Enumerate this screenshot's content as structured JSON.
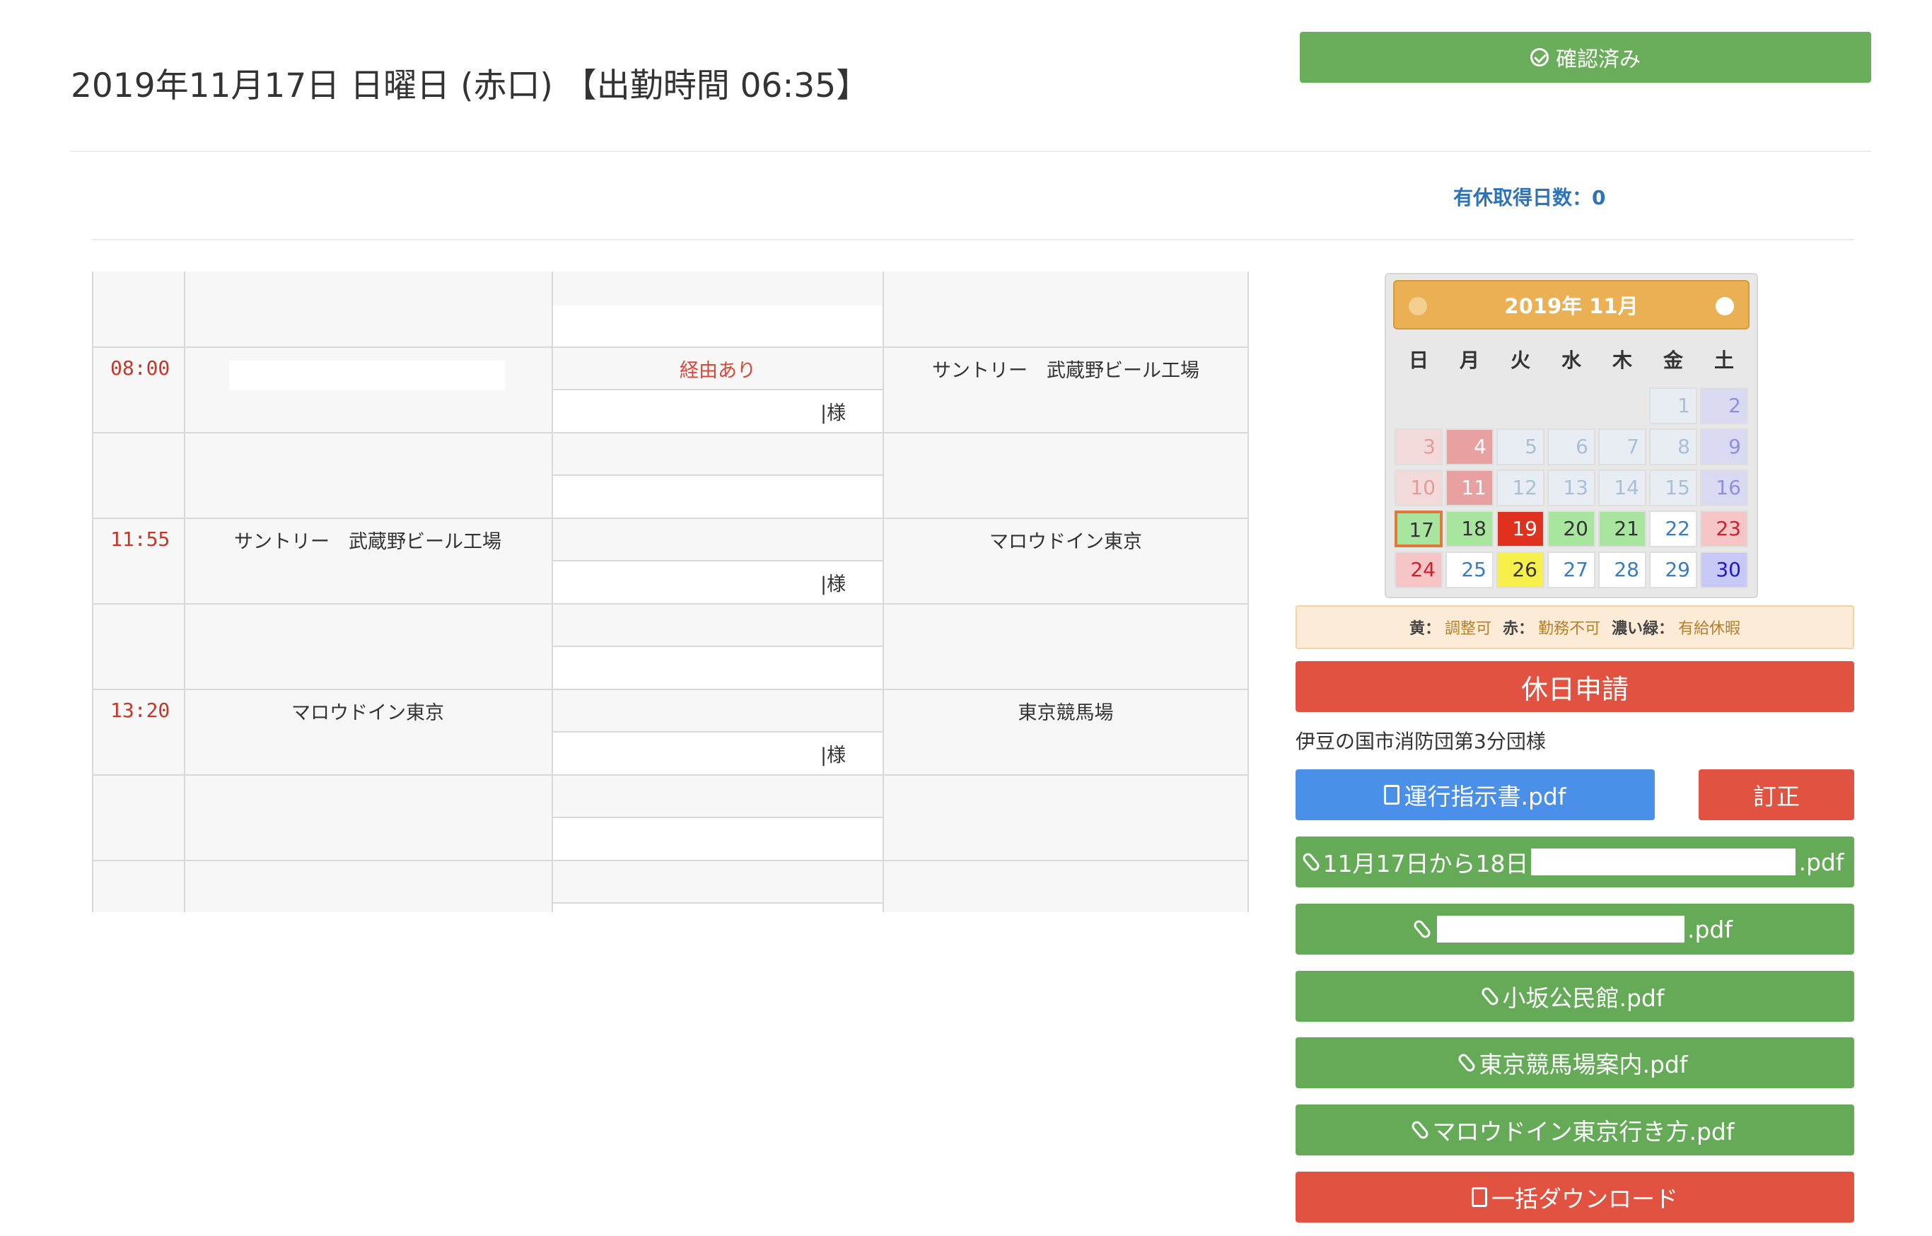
{
  "header": {
    "title": "2019年11月17日  日曜日  (赤口) 【出勤時間 06:35】",
    "confirm_label": "確認済み",
    "paid_leave": "有休取得日数：0"
  },
  "schedule": {
    "rows": [
      {
        "time": "",
        "from": "",
        "via_top": "",
        "via_bottom": "",
        "to": ""
      },
      {
        "time": "08:00",
        "from": "",
        "via_top": "経由あり",
        "via_bottom": "|様",
        "to": "サントリー　武蔵野ビール工場"
      },
      {
        "time": "",
        "from": "",
        "via_top": "",
        "via_bottom": "",
        "to": ""
      },
      {
        "time": "11:55",
        "from": "サントリー　武蔵野ビール工場",
        "via_top": "",
        "via_bottom": "|様",
        "to": "マロウドイン東京"
      },
      {
        "time": "",
        "from": "",
        "via_top": "",
        "via_bottom": "",
        "to": ""
      },
      {
        "time": "13:20",
        "from": "マロウドイン東京",
        "via_top": "",
        "via_bottom": "|様",
        "to": "東京競馬場"
      },
      {
        "time": "",
        "from": "",
        "via_top": "",
        "via_bottom": "",
        "to": ""
      },
      {
        "time": "",
        "from": "",
        "via_top": "",
        "via_bottom": "",
        "to": ""
      }
    ]
  },
  "calendar": {
    "title": "2019年 11月",
    "weekdays": [
      "日",
      "月",
      "火",
      "水",
      "木",
      "金",
      "土"
    ],
    "weeks": [
      [
        null,
        null,
        null,
        null,
        null,
        1,
        2
      ],
      [
        3,
        4,
        5,
        6,
        7,
        8,
        9
      ],
      [
        10,
        11,
        12,
        13,
        14,
        15,
        16
      ],
      [
        17,
        18,
        19,
        20,
        21,
        22,
        23
      ],
      [
        24,
        25,
        26,
        27,
        28,
        29,
        30
      ]
    ],
    "day_styles": {
      "1": {
        "bg": "#e8edf3",
        "fg": "#a8bfd6"
      },
      "2": {
        "bg": "#d9d9f2",
        "fg": "#8f8fdd"
      },
      "3": {
        "bg": "#f2dada",
        "fg": "#e79a9a"
      },
      "4": {
        "bg": "#e8a0a0",
        "fg": "#ffffff"
      },
      "5": {
        "bg": "#e8edf3",
        "fg": "#a8bfd6"
      },
      "6": {
        "bg": "#e8edf3",
        "fg": "#a8bfd6"
      },
      "7": {
        "bg": "#e8edf3",
        "fg": "#a8bfd6"
      },
      "8": {
        "bg": "#e8edf3",
        "fg": "#a8bfd6"
      },
      "9": {
        "bg": "#d9d9f2",
        "fg": "#8f8fdd"
      },
      "10": {
        "bg": "#f2dada",
        "fg": "#e79a9a"
      },
      "11": {
        "bg": "#e8a0a0",
        "fg": "#ffffff"
      },
      "12": {
        "bg": "#e8edf3",
        "fg": "#a8bfd6"
      },
      "13": {
        "bg": "#e8edf3",
        "fg": "#a8bfd6"
      },
      "14": {
        "bg": "#e8edf3",
        "fg": "#a8bfd6"
      },
      "15": {
        "bg": "#e8edf3",
        "fg": "#a8bfd6"
      },
      "16": {
        "bg": "#d9d9f2",
        "fg": "#8f8fdd"
      },
      "17": {
        "bg": "#a8e6a0",
        "fg": "#333333",
        "border": "#e07a3a"
      },
      "18": {
        "bg": "#a8e6a0",
        "fg": "#333333"
      },
      "19": {
        "bg": "#e0301e",
        "fg": "#ffffff"
      },
      "20": {
        "bg": "#a8e6a0",
        "fg": "#333333"
      },
      "21": {
        "bg": "#a8e6a0",
        "fg": "#333333"
      },
      "22": {
        "bg": "#ffffff",
        "fg": "#3a7cc0"
      },
      "23": {
        "bg": "#f6c6c6",
        "fg": "#d0202a"
      },
      "24": {
        "bg": "#f6c6c6",
        "fg": "#d0202a"
      },
      "25": {
        "bg": "#ffffff",
        "fg": "#3a7cc0"
      },
      "26": {
        "bg": "#f8f04a",
        "fg": "#333333"
      },
      "27": {
        "bg": "#ffffff",
        "fg": "#3a7cc0"
      },
      "28": {
        "bg": "#ffffff",
        "fg": "#3a7cc0"
      },
      "29": {
        "bg": "#ffffff",
        "fg": "#3a7cc0"
      },
      "30": {
        "bg": "#c8c8f6",
        "fg": "#1a1ad0"
      }
    }
  },
  "legend": {
    "yellow_key": "黄：",
    "yellow_val": "調整可",
    "red_key": "赤：",
    "red_val": "勤務不可",
    "green_key": "濃い緑：",
    "green_val": "有給休暇"
  },
  "actions": {
    "holiday_request": "休日申請",
    "org_name": "伊豆の国市消防団第3分団様",
    "instruction_pdf": "運行指示書.pdf",
    "correction": "訂正",
    "file1_prefix": "11月17日から18日",
    "file_ext": ".pdf",
    "file3": "小坂公民館.pdf",
    "file4": "東京競馬場案内.pdf",
    "file5": "マロウドイン東京行き方.pdf",
    "bulk_download": "一括ダウンロード"
  },
  "colors": {
    "green": "#64aa57",
    "red": "#e25240",
    "blue": "#4a8fe8",
    "calendar_header": "#eab053"
  }
}
